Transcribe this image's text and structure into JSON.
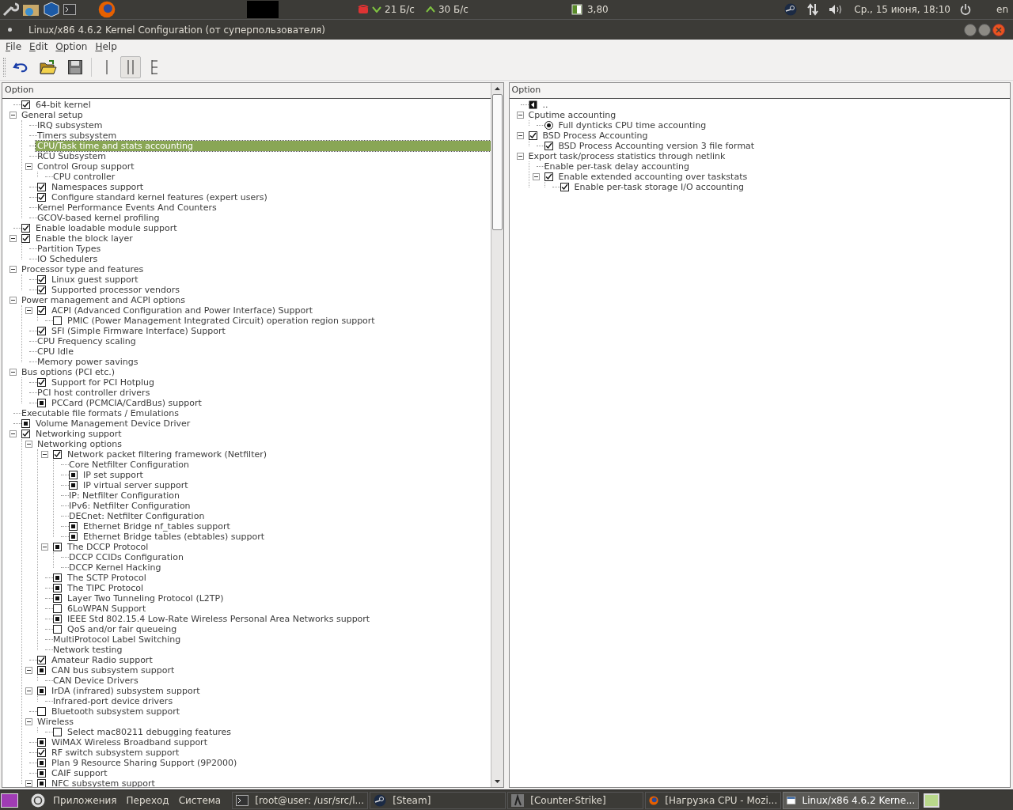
{
  "top_panel": {
    "net_down": "21 Б/с",
    "net_up": "30 Б/с",
    "load": "3,80",
    "clock": "Ср., 15 июня, 18:10",
    "keyboard": "en"
  },
  "window": {
    "title": "Linux/x86 4.6.2 Kernel Configuration (от суперпользователя)"
  },
  "menu": [
    {
      "label": "File"
    },
    {
      "label": "Edit"
    },
    {
      "label": "Option"
    },
    {
      "label": "Help"
    }
  ],
  "toolbar": [
    {
      "kind": "undo",
      "selected": false
    },
    {
      "kind": "open",
      "selected": false
    },
    {
      "kind": "save",
      "selected": false
    },
    {
      "kind": "single",
      "selected": false
    },
    {
      "kind": "split",
      "selected": true
    },
    {
      "kind": "full",
      "selected": false
    }
  ],
  "left_tree": {
    "header": "Option",
    "items": [
      {
        "label": "64-bit kernel",
        "kind": "check",
        "checked": true,
        "selected": false
      },
      {
        "label": "General setup",
        "kind": "menu",
        "expanded": true,
        "selected": false,
        "children": [
          {
            "label": "IRQ subsystem",
            "kind": "menu",
            "selected": false
          },
          {
            "label": "Timers subsystem",
            "kind": "menu",
            "selected": false
          },
          {
            "label": "CPU/Task time and stats accounting",
            "kind": "menu",
            "selected": true
          },
          {
            "label": "RCU Subsystem",
            "kind": "menu",
            "selected": false
          },
          {
            "label": "Control Group support",
            "kind": "menu",
            "expanded": true,
            "selected": false,
            "children": [
              {
                "label": "CPU controller",
                "kind": "menu",
                "selected": false
              }
            ]
          },
          {
            "label": "Namespaces support",
            "kind": "check",
            "checked": true,
            "selected": false
          },
          {
            "label": "Configure standard kernel features (expert users)",
            "kind": "check",
            "checked": true,
            "selected": false
          },
          {
            "label": "Kernel Performance Events And Counters",
            "kind": "menu",
            "selected": false
          },
          {
            "label": "GCOV-based kernel profiling",
            "kind": "menu",
            "selected": false
          }
        ]
      },
      {
        "label": "Enable loadable module support",
        "kind": "check",
        "checked": true,
        "selected": false
      },
      {
        "label": "Enable the block layer",
        "kind": "check",
        "checked": true,
        "expanded": true,
        "selected": false,
        "children": [
          {
            "label": "Partition Types",
            "kind": "menu",
            "selected": false
          },
          {
            "label": "IO Schedulers",
            "kind": "menu",
            "selected": false
          }
        ]
      },
      {
        "label": "Processor type and features",
        "kind": "menu",
        "expanded": true,
        "selected": false,
        "children": [
          {
            "label": "Linux guest support",
            "kind": "check",
            "checked": true,
            "selected": false
          },
          {
            "label": "Supported processor vendors",
            "kind": "check",
            "checked": true,
            "selected": false
          }
        ]
      },
      {
        "label": "Power management and ACPI options",
        "kind": "menu",
        "expanded": true,
        "selected": false,
        "children": [
          {
            "label": "ACPI (Advanced Configuration and Power Interface) Support",
            "kind": "check",
            "checked": true,
            "expanded": true,
            "selected": false,
            "children": [
              {
                "label": "PMIC (Power Management Integrated Circuit) operation region support",
                "kind": "check",
                "checked": false,
                "selected": false
              }
            ]
          },
          {
            "label": "SFI (Simple Firmware Interface) Support",
            "kind": "check",
            "checked": true,
            "selected": false
          },
          {
            "label": "CPU Frequency scaling",
            "kind": "menu",
            "selected": false
          },
          {
            "label": "CPU Idle",
            "kind": "menu",
            "selected": false
          },
          {
            "label": "Memory power savings",
            "kind": "menu",
            "selected": false
          }
        ]
      },
      {
        "label": "Bus options (PCI etc.)",
        "kind": "menu",
        "expanded": true,
        "selected": false,
        "children": [
          {
            "label": "Support for PCI Hotplug",
            "kind": "check",
            "checked": true,
            "selected": false
          },
          {
            "label": "PCI host controller drivers",
            "kind": "menu",
            "selected": false
          },
          {
            "label": "PCCard (PCMCIA/CardBus) support",
            "kind": "module",
            "checked": true,
            "selected": false
          }
        ]
      },
      {
        "label": "Executable file formats / Emulations",
        "kind": "menu",
        "selected": false
      },
      {
        "label": "Volume Management Device Driver",
        "kind": "module",
        "checked": true,
        "selected": false
      },
      {
        "label": "Networking support",
        "kind": "check",
        "checked": true,
        "expanded": true,
        "selected": false,
        "children": [
          {
            "label": "Networking options",
            "kind": "menu",
            "expanded": true,
            "selected": false,
            "children": [
              {
                "label": "Network packet filtering framework (Netfilter)",
                "kind": "check",
                "checked": true,
                "expanded": true,
                "selected": false,
                "children": [
                  {
                    "label": "Core Netfilter Configuration",
                    "kind": "menu",
                    "selected": false
                  },
                  {
                    "label": "IP set support",
                    "kind": "module",
                    "checked": true,
                    "selected": false
                  },
                  {
                    "label": "IP virtual server support",
                    "kind": "module",
                    "checked": true,
                    "selected": false
                  },
                  {
                    "label": "IP: Netfilter Configuration",
                    "kind": "menu",
                    "selected": false
                  },
                  {
                    "label": "IPv6: Netfilter Configuration",
                    "kind": "menu",
                    "selected": false
                  },
                  {
                    "label": "DECnet: Netfilter Configuration",
                    "kind": "menu",
                    "selected": false
                  },
                  {
                    "label": "Ethernet Bridge nf_tables support",
                    "kind": "module",
                    "checked": true,
                    "selected": false
                  },
                  {
                    "label": "Ethernet Bridge tables (ebtables) support",
                    "kind": "module",
                    "checked": true,
                    "selected": false
                  }
                ]
              },
              {
                "label": "The DCCP Protocol",
                "kind": "module",
                "checked": true,
                "expanded": true,
                "selected": false,
                "children": [
                  {
                    "label": "DCCP CCIDs Configuration",
                    "kind": "menu",
                    "selected": false
                  },
                  {
                    "label": "DCCP Kernel Hacking",
                    "kind": "menu",
                    "selected": false
                  }
                ]
              },
              {
                "label": "The SCTP Protocol",
                "kind": "module",
                "checked": true,
                "selected": false
              },
              {
                "label": "The TIPC Protocol",
                "kind": "module",
                "checked": true,
                "selected": false
              },
              {
                "label": "Layer Two Tunneling Protocol (L2TP)",
                "kind": "module",
                "checked": true,
                "selected": false
              },
              {
                "label": "6LoWPAN Support",
                "kind": "check",
                "checked": false,
                "selected": false
              },
              {
                "label": "IEEE Std 802.15.4 Low-Rate Wireless Personal Area Networks support",
                "kind": "module",
                "checked": true,
                "selected": false
              },
              {
                "label": "QoS and/or fair queueing",
                "kind": "check",
                "checked": false,
                "selected": false
              },
              {
                "label": "MultiProtocol Label Switching",
                "kind": "menu",
                "selected": false
              },
              {
                "label": "Network testing",
                "kind": "menu",
                "selected": false
              }
            ]
          },
          {
            "label": "Amateur Radio support",
            "kind": "check",
            "checked": true,
            "selected": false
          },
          {
            "label": "CAN bus subsystem support",
            "kind": "module",
            "checked": true,
            "expanded": true,
            "selected": false,
            "children": [
              {
                "label": "CAN Device Drivers",
                "kind": "menu",
                "selected": false
              }
            ]
          },
          {
            "label": "IrDA (infrared) subsystem support",
            "kind": "module",
            "checked": true,
            "expanded": true,
            "selected": false,
            "children": [
              {
                "label": "Infrared-port device drivers",
                "kind": "menu",
                "selected": false
              }
            ]
          },
          {
            "label": "Bluetooth subsystem support",
            "kind": "check",
            "checked": false,
            "selected": false
          },
          {
            "label": "Wireless",
            "kind": "menu",
            "expanded": true,
            "selected": false,
            "children": [
              {
                "label": "Select mac80211 debugging features",
                "kind": "check",
                "checked": false,
                "selected": false
              }
            ]
          },
          {
            "label": "WiMAX Wireless Broadband support",
            "kind": "module",
            "checked": true,
            "selected": false
          },
          {
            "label": "RF switch subsystem support",
            "kind": "check",
            "checked": true,
            "selected": false
          },
          {
            "label": "Plan 9 Resource Sharing Support (9P2000)",
            "kind": "module",
            "checked": true,
            "selected": false
          },
          {
            "label": "CAIF support",
            "kind": "module",
            "checked": true,
            "selected": false
          },
          {
            "label": "NFC subsystem support",
            "kind": "module",
            "checked": true,
            "expanded": true,
            "selected": false
          }
        ]
      }
    ]
  },
  "right_tree": {
    "header": "Option",
    "items": [
      {
        "label": "..",
        "kind": "back",
        "selected": false
      },
      {
        "label": "Cputime accounting",
        "kind": "menu",
        "expanded": true,
        "selected": false,
        "children": [
          {
            "label": "Full dynticks CPU time accounting",
            "kind": "radio",
            "checked": true,
            "selected": false
          }
        ]
      },
      {
        "label": "BSD Process Accounting",
        "kind": "check",
        "checked": true,
        "expanded": true,
        "selected": false,
        "children": [
          {
            "label": "BSD Process Accounting version 3 file format",
            "kind": "check",
            "checked": true,
            "selected": false
          }
        ]
      },
      {
        "label": "Export task/process statistics through netlink",
        "kind": "menu",
        "expanded": true,
        "selected": false,
        "children": [
          {
            "label": "Enable per-task delay accounting",
            "kind": "menu",
            "selected": false
          },
          {
            "label": "Enable extended accounting over taskstats",
            "kind": "check",
            "checked": true,
            "expanded": true,
            "selected": false,
            "children": [
              {
                "label": "Enable per-task storage I/O accounting",
                "kind": "check",
                "checked": true,
                "selected": false
              }
            ]
          }
        ]
      }
    ]
  },
  "taskbar": {
    "menus": [
      "Приложения",
      "Переход",
      "Система"
    ],
    "tasks": [
      {
        "label": "[root@user: /usr/src/l...",
        "kind": "terminal",
        "selected": false
      },
      {
        "label": "[Steam]",
        "kind": "steam",
        "selected": false
      },
      {
        "label": "[Counter-Strike]",
        "kind": "game",
        "selected": false
      },
      {
        "label": "[Нагрузка CPU - Mozi...",
        "kind": "firefox",
        "selected": false
      },
      {
        "label": "Linux/x86 4.6.2 Kerne...",
        "kind": "window",
        "selected": true
      }
    ]
  }
}
